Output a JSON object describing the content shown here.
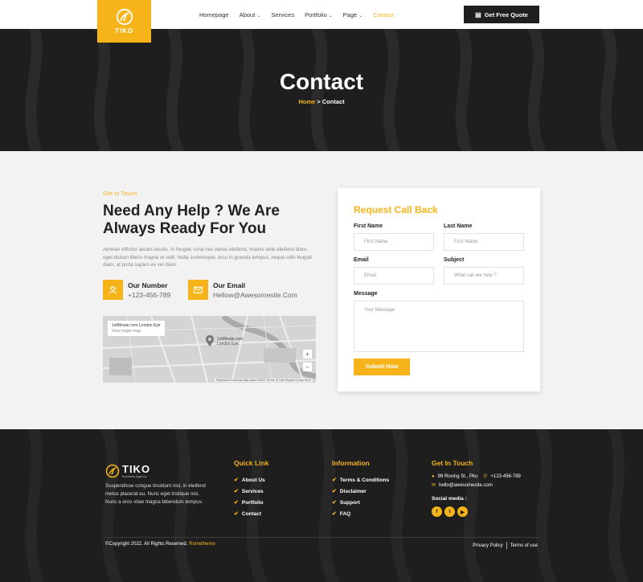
{
  "nav": {
    "logo_text": "TIKO",
    "items": [
      {
        "label": "Homepage",
        "has_caret": false,
        "active": false
      },
      {
        "label": "About",
        "has_caret": true,
        "active": false
      },
      {
        "label": "Services",
        "has_caret": false,
        "active": false
      },
      {
        "label": "Portfolio",
        "has_caret": true,
        "active": false
      },
      {
        "label": "Page",
        "has_caret": true,
        "active": false
      },
      {
        "label": "Contact",
        "has_caret": false,
        "active": true
      }
    ],
    "cta_label": "Get Free Quote"
  },
  "hero": {
    "title": "Contact",
    "breadcrumb_home": "Home",
    "breadcrumb_sep": ">",
    "breadcrumb_current": "Contact"
  },
  "contact": {
    "kicker": "Get In Touch",
    "heading": "Need Any Help ? We Are Always Ready For You",
    "intro": "Aenean efficitur iaculis iaculis. In feugiat, urna nec varius eleifend, mauris ante eleifend diam, eget dictum libero magna et velit. Nulla scelerisque, arcu in gravida tempus, neque odio feugiat diam, at porta sapien ex vel diam.",
    "number_label": "Our Number",
    "number_value": "+123-456-789",
    "email_label": "Our Email",
    "email_value": "Hellow@Awesomesite.Com"
  },
  "map": {
    "place_title": "1stMinute.com London Eye",
    "place_sub": "View larger map",
    "marker_label": "1stMinute.com London Eye",
    "footer_text": "Keyboard shortcuts   Map data ©2022   Terms of Use   Report a map error",
    "zoom_in": "+",
    "zoom_out": "−"
  },
  "form": {
    "title": "Request Call Back",
    "first_name_label": "First Name",
    "first_name_placeholder": "First Name",
    "last_name_label": "Last Name",
    "last_name_placeholder": "First Name",
    "email_label": "Email",
    "email_placeholder": "Email",
    "subject_label": "Subject",
    "subject_placeholder": "What can we help ?",
    "message_label": "Message",
    "message_placeholder": "Your Message",
    "submit_label": "Submit Now"
  },
  "footer": {
    "logo_name": "TIKO",
    "logo_tagline": "Business Agency",
    "description": "Suspendisse congue tincidunt nisi, in eleifend metus placerat eu. Nunc eget tristique nisi. Nunc a eros vitae magna bibendum tempus.",
    "quick_link_title": "Quick Link",
    "quick_links": [
      "About Us",
      "Services",
      "Portfolio",
      "Contact"
    ],
    "information_title": "Information",
    "information_links": [
      "Terms & Conditions",
      "Disclaimer",
      "Support",
      "FAQ"
    ],
    "get_in_touch_title": "Get In Touch",
    "address": "99 Roving St., Pku",
    "phone": "+123-456-789",
    "email": "hello@awesomesite.com",
    "social_title": "Social media :",
    "copyright": "©Copyright 2022. All Rights Reserved.",
    "copyright_brand": "Rometheme",
    "privacy": "Privacy Policy",
    "terms": "Terms of use"
  },
  "colors": {
    "accent": "#f7b41a",
    "dark": "#1e1e1e",
    "content_bg": "#f2f2f2"
  }
}
